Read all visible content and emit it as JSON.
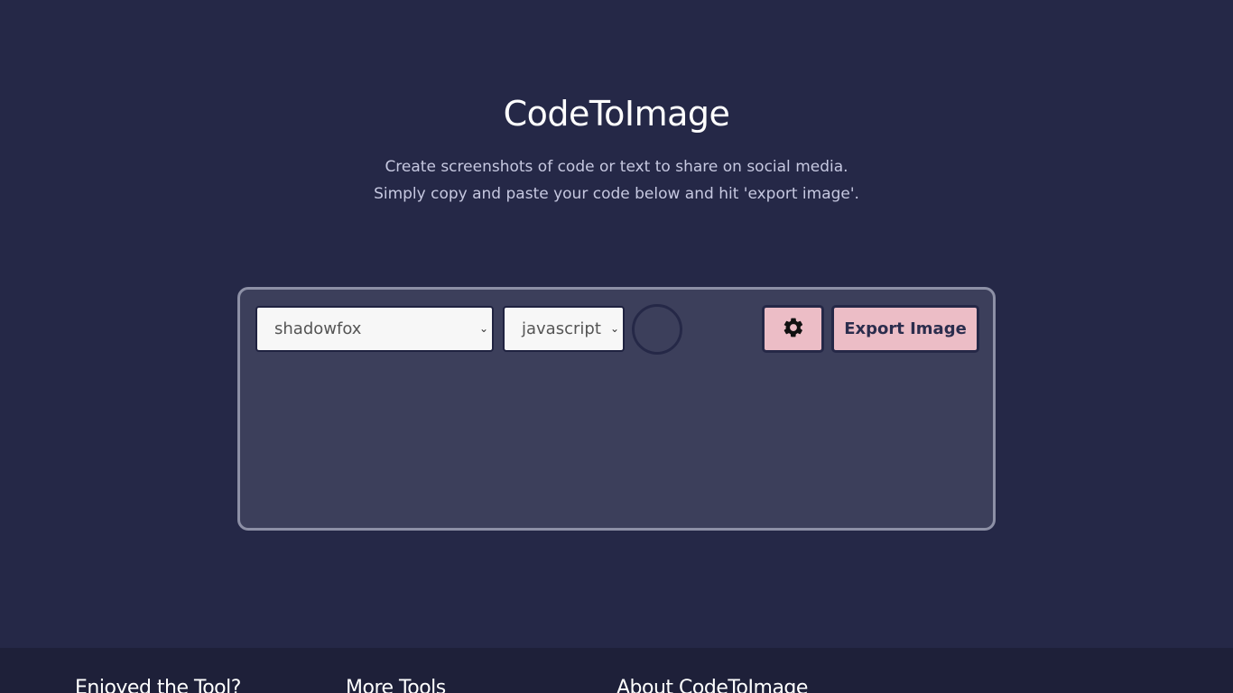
{
  "header": {
    "title": "CodeToImage",
    "subtitle_line1": "Create screenshots of code or text to share on social media.",
    "subtitle_line2": "Simply copy and paste your code below and hit 'export image'."
  },
  "toolbar": {
    "theme_select_value": "shadowfox",
    "language_select_value": "javascript",
    "settings_icon": "gear-icon",
    "export_label": "Export Image"
  },
  "editor": {
    "content": ""
  },
  "footer": {
    "headings": [
      "Enjoyed the Tool?",
      "More Tools",
      "About CodeToImage"
    ]
  },
  "colors": {
    "background": "#252847",
    "card": "#3c3f5b",
    "accent_button": "#ecbdc6",
    "footer": "#1e2039"
  }
}
